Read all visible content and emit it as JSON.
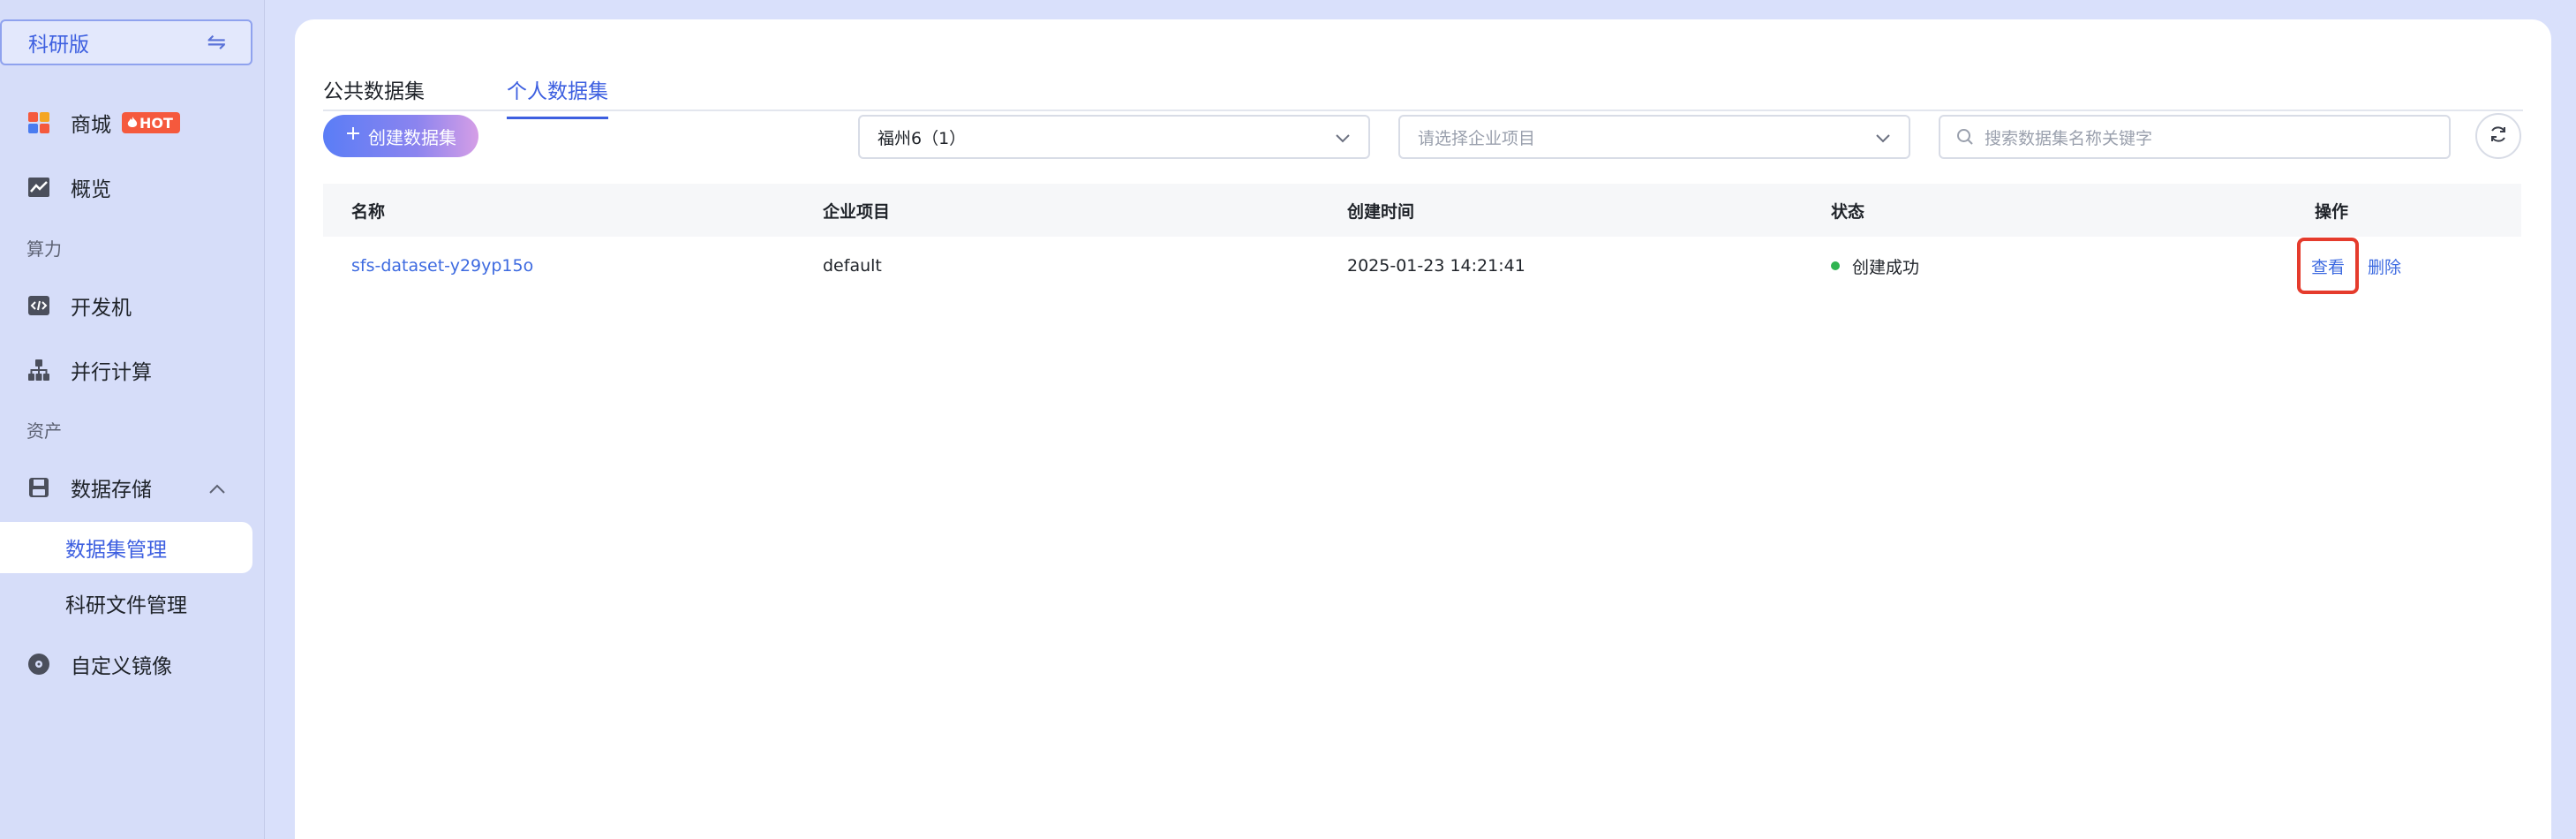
{
  "sidebar": {
    "edition_label": "科研版",
    "swap_icon": "swap-arrows-icon",
    "items": {
      "mall": {
        "label": "商城",
        "badge": "HOT",
        "icon": "apps-grid-icon"
      },
      "overview": {
        "label": "概览",
        "icon": "chart-icon"
      },
      "group_compute": "算力",
      "devbox": {
        "label": "开发机",
        "icon": "code-icon"
      },
      "parallel": {
        "label": "并行计算",
        "icon": "hierarchy-icon"
      },
      "group_assets": "资产",
      "storage": {
        "label": "数据存储",
        "icon": "save-disk-icon"
      },
      "dataset_mgmt": {
        "label": "数据集管理"
      },
      "file_mgmt": {
        "label": "科研文件管理"
      },
      "images": {
        "label": "自定义镜像",
        "icon": "disc-icon"
      }
    }
  },
  "main": {
    "tabs": [
      {
        "label": "公共数据集",
        "active": false
      },
      {
        "label": "个人数据集",
        "active": true
      }
    ],
    "create_button": "创建数据集",
    "region_select": "福州6（1）",
    "project_select_placeholder": "请选择企业项目",
    "search_placeholder": "搜索数据集名称关键字",
    "table": {
      "headers": [
        "名称",
        "企业项目",
        "创建时间",
        "状态",
        "操作"
      ],
      "rows": [
        {
          "name": "sfs-dataset-y29yp15o",
          "project": "default",
          "created": "2025-01-23 14:21:41",
          "status": "创建成功",
          "actions": [
            "查看",
            "删除"
          ]
        }
      ]
    }
  },
  "colors": {
    "accent": "#3d5fe0",
    "status_success": "#30b450",
    "highlight_box": "#e53b2c",
    "hot_badge": "#f5593d"
  }
}
